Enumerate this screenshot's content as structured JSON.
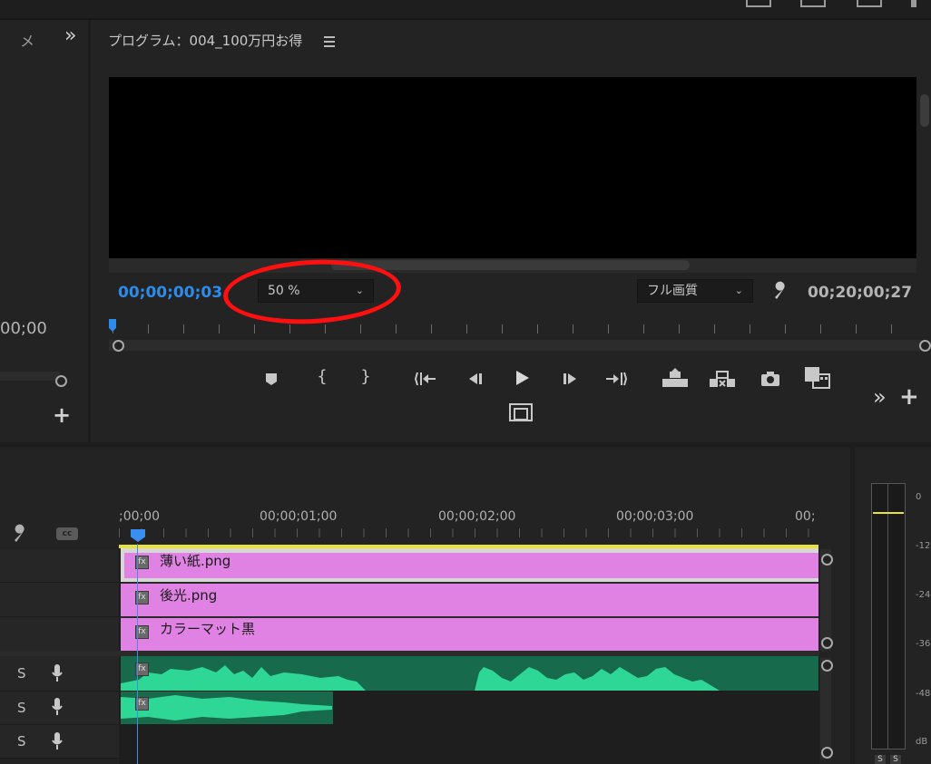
{
  "monitor": {
    "title": "プログラム：004_100万円お得",
    "menu_icon": "hamburger-icon",
    "current_timecode": "00;00;00;03",
    "zoom": "50 %",
    "quality": "フル画質",
    "duration_timecode": "00;20;00;27",
    "annotation_color": "#ff1010"
  },
  "left_panel": {
    "tab_fragment": "メ",
    "overflow": "»",
    "timecode_fragment": "00;00",
    "add": "+"
  },
  "transport": {
    "buttons": [
      "marker",
      "mark-in",
      "mark-out",
      "go-to-in",
      "step-back",
      "play",
      "step-forward",
      "go-to-out",
      "lift",
      "extract",
      "export-frame",
      "comparison-view"
    ],
    "overflow": "»",
    "add": "+"
  },
  "timeline": {
    "ruler_labels": [
      ";00;00",
      "00;00;01;00",
      "00;00;02;00",
      "00;00;03;00",
      "00;"
    ],
    "video_clips": [
      {
        "fx": "fx",
        "label": "薄い紙.png"
      },
      {
        "fx": "fx",
        "label": "後光.png"
      },
      {
        "fx": "fx",
        "label": "カラーマット黒"
      }
    ],
    "audio_tracks": [
      {
        "s": "S"
      },
      {
        "s": "S"
      },
      {
        "s": "S"
      }
    ],
    "audio_fx": [
      "fx",
      "fx"
    ],
    "clip_color_video": "#e082e3",
    "clip_color_audio": "#176a4c",
    "waveform_color": "#2fd797",
    "playhead_color": "#3a8ef0"
  },
  "meter": {
    "ticks": [
      "0",
      "-12",
      "-24",
      "-36",
      "-48",
      "dB"
    ],
    "buttons": [
      "S",
      "S"
    ]
  }
}
